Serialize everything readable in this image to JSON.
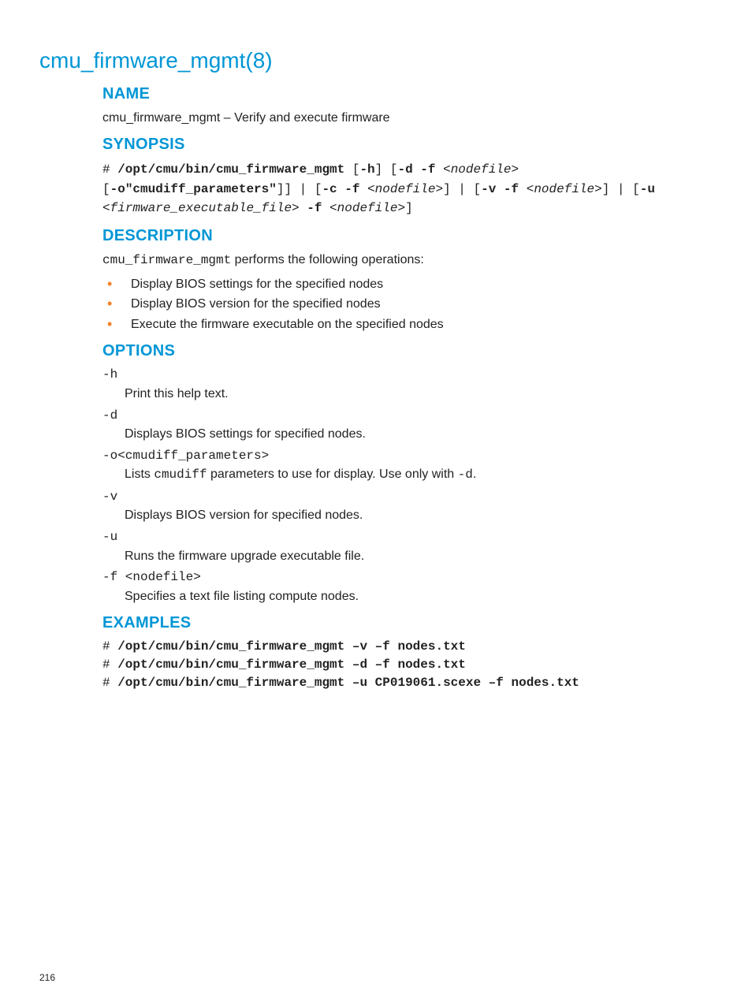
{
  "pageTitle": "cmu_firmware_mgmt(8)",
  "pageNumber": "216",
  "name": {
    "heading": "NAME",
    "line_pre": "cmu_firmware_mgmt – ",
    "line_post": "Verify and execute firmware"
  },
  "synopsis": {
    "heading": "SYNOPSIS",
    "s_hash": "# ",
    "s_cmd": "/opt/cmu/bin/cmu_firmware_mgmt",
    "s_t1": " [",
    "s_h": "-h",
    "s_t2": "] [",
    "s_df": "-d -f",
    "s_t3": " <",
    "s_nodefile1": "nodefile",
    "s_t4": "> ",
    "s_t5": "[",
    "s_o": "-o\"cmudiff_parameters\"",
    "s_t6": "]] | [",
    "s_cf": "-c -f",
    "s_t7": " <",
    "s_nodefile2": "nodefile",
    "s_t8": ">] | [",
    "s_vf": "-v -f",
    "s_t9": " <",
    "s_nodefile3": "nodefile",
    "s_t10": ">] | [",
    "s_u": "-u",
    "s_t11": " <",
    "s_fwfile": "firmware_executable_file",
    "s_t12": "> ",
    "s_f": "-f",
    "s_t13": " <",
    "s_nodefile4": "nodefile",
    "s_t14": ">]"
  },
  "description": {
    "heading": "DESCRIPTION",
    "intro_cmd": "cmu_firmware_mgmt",
    "intro_rest": " performs the following operations:",
    "bullets": [
      "Display BIOS settings for the specified nodes",
      "Display BIOS version for the specified nodes",
      "Execute the firmware executable on the specified nodes"
    ]
  },
  "options": {
    "heading": "OPTIONS",
    "items": [
      {
        "flag": "-h",
        "desc_pre": "Print this help text.",
        "desc_mid": "",
        "desc_post": "",
        "desc_mid2": "",
        "desc_post2": ""
      },
      {
        "flag": "-d",
        "desc_pre": "Displays BIOS settings for specified nodes.",
        "desc_mid": "",
        "desc_post": "",
        "desc_mid2": "",
        "desc_post2": ""
      },
      {
        "flag": "-o<cmudiff_parameters>",
        "desc_pre": "Lists ",
        "desc_mid": "cmudiff",
        "desc_post": " parameters to use for display. Use only with ",
        "desc_mid2": "-d",
        "desc_post2": "."
      },
      {
        "flag": "-v",
        "desc_pre": "Displays BIOS version for specified nodes.",
        "desc_mid": "",
        "desc_post": "",
        "desc_mid2": "",
        "desc_post2": ""
      },
      {
        "flag": "-u",
        "desc_pre": "Runs the firmware upgrade executable file.",
        "desc_mid": "",
        "desc_post": "",
        "desc_mid2": "",
        "desc_post2": ""
      },
      {
        "flag": "-f <nodefile>",
        "desc_pre": "Specifies a text file listing compute nodes.",
        "desc_mid": "",
        "desc_post": "",
        "desc_mid2": "",
        "desc_post2": ""
      }
    ]
  },
  "examples": {
    "heading": "EXAMPLES",
    "lines": [
      {
        "hash": "# ",
        "cmd": "/opt/cmu/bin/cmu_firmware_mgmt –v –f nodes.txt"
      },
      {
        "hash": "# ",
        "cmd": "/opt/cmu/bin/cmu_firmware_mgmt –d –f nodes.txt"
      },
      {
        "hash": "# ",
        "cmd": "/opt/cmu/bin/cmu_firmware_mgmt –u CP019061.scexe –f nodes.txt"
      }
    ]
  }
}
